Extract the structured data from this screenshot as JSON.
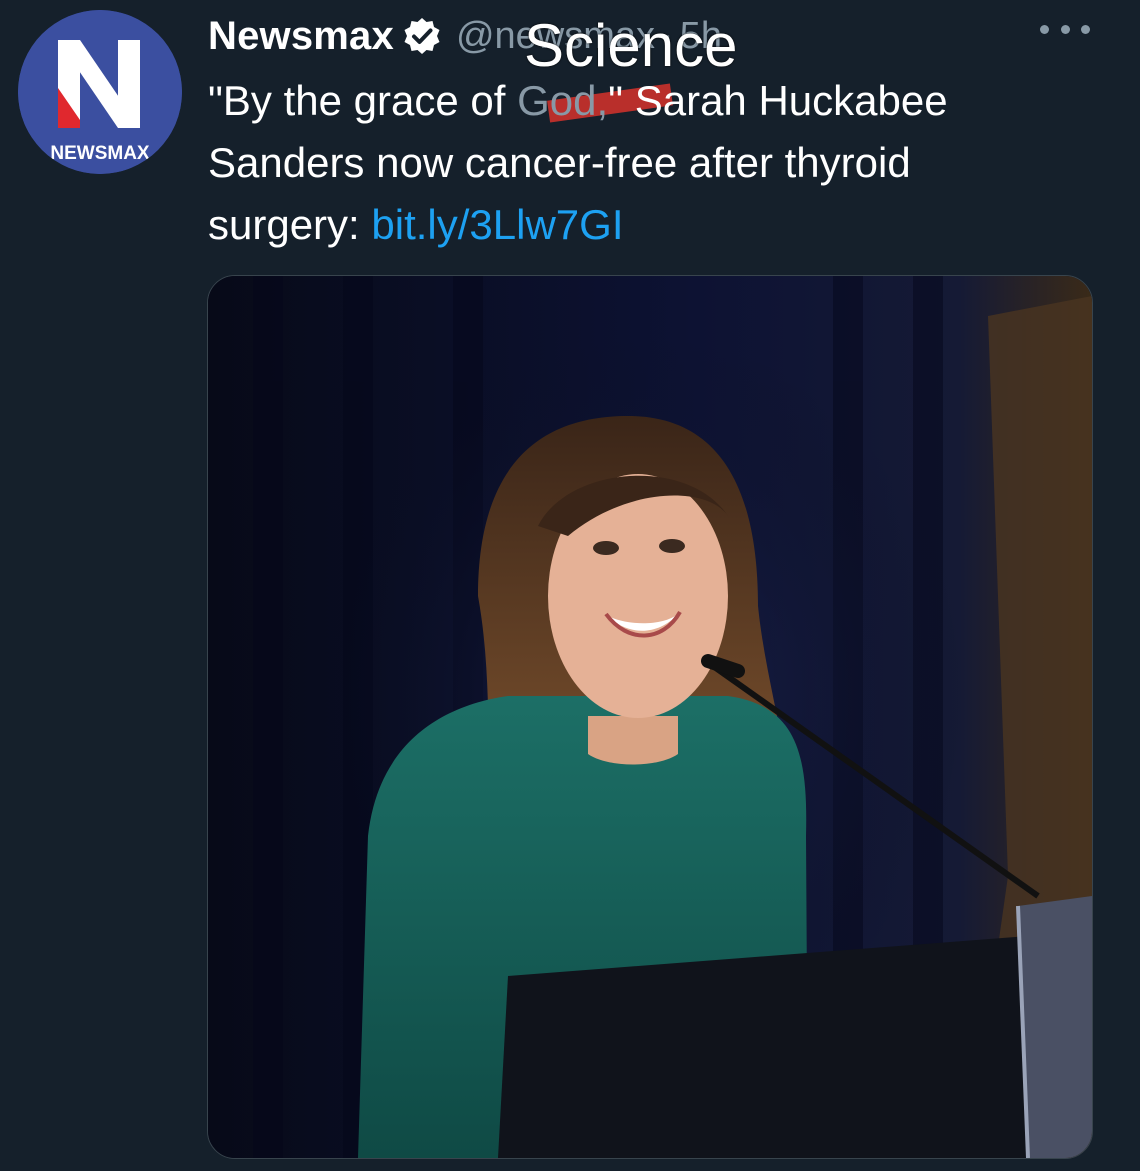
{
  "account": {
    "display_name": "Newsmax",
    "handle": "@newsmax",
    "separator": "·",
    "time": "5h",
    "avatar_text": "NEWSMAX",
    "avatar_letter": "N"
  },
  "overlay": {
    "handwritten_word": "Science"
  },
  "tweet": {
    "line1_before": "\"By the grace of ",
    "line1_struck": "God,",
    "line1_after": "\" Sarah Huckabee",
    "line2": "Sanders now cancer-free after thyroid",
    "line3_before": "surgery: ",
    "link": "bit.ly/3Llw7GI"
  },
  "colors": {
    "background": "#15202b",
    "secondary_text": "#8899a6",
    "link": "#1da1f2",
    "avatar_bg": "#3b4fa0",
    "strike": "#c8312b"
  },
  "icons": {
    "verified": "verified-badge-icon",
    "more": "more-options-icon"
  },
  "media": {
    "alt": "Photo of a woman in a green dress speaking at a podium with a microphone"
  }
}
